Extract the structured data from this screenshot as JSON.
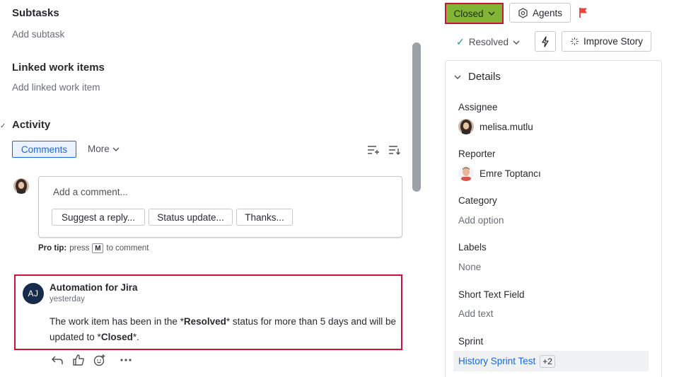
{
  "left": {
    "subtasks_title": "Subtasks",
    "add_subtask": "Add subtask",
    "linked_title": "Linked work items",
    "add_linked": "Add linked work item",
    "activity_title": "Activity",
    "activity_caret": "✓",
    "tabs": {
      "comments": "Comments",
      "more": "More"
    },
    "comment_placeholder": "Add a comment...",
    "chips": [
      "Suggest a reply...",
      "Status update...",
      "Thanks..."
    ],
    "pro_tip": {
      "label": "Pro tip:",
      "press": "press",
      "key": "M",
      "suffix": "to comment"
    },
    "automation_comment": {
      "initials": "AJ",
      "author": "Automation for Jira",
      "time": "yesterday",
      "body_pre": "The work item has been in the *",
      "body_bold1": "Resolved",
      "body_mid": "* status for more than 5 days and will be updated to *",
      "body_bold2": "Closed",
      "body_post": "*."
    }
  },
  "right": {
    "status_button": "Closed",
    "agents_button": "Agents",
    "resolution": "Resolved",
    "improve_button": "Improve Story",
    "details_title": "Details",
    "fields": {
      "assignee_label": "Assignee",
      "assignee": "melisa.mutlu",
      "reporter_label": "Reporter",
      "reporter": "Emre Toptancı",
      "category_label": "Category",
      "category_value": "Add option",
      "labels_label": "Labels",
      "labels_value": "None",
      "short_text_label": "Short Text Field",
      "short_text_value": "Add text",
      "sprint_label": "Sprint",
      "sprint_value": "History Sprint Test",
      "sprint_extra": "+2"
    }
  },
  "colors": {
    "accent_blue": "#1868db",
    "status_green": "#82b536",
    "highlight_red": "#d0103a",
    "flag_red": "#e2483d"
  },
  "icons": [
    "chevron-down-icon",
    "agents-icon",
    "flag-icon",
    "check-icon",
    "bolt-icon",
    "sparkle-icon",
    "sort-icon",
    "reply-icon",
    "thumbs-up-icon",
    "emoji-add-icon",
    "more-icon"
  ]
}
